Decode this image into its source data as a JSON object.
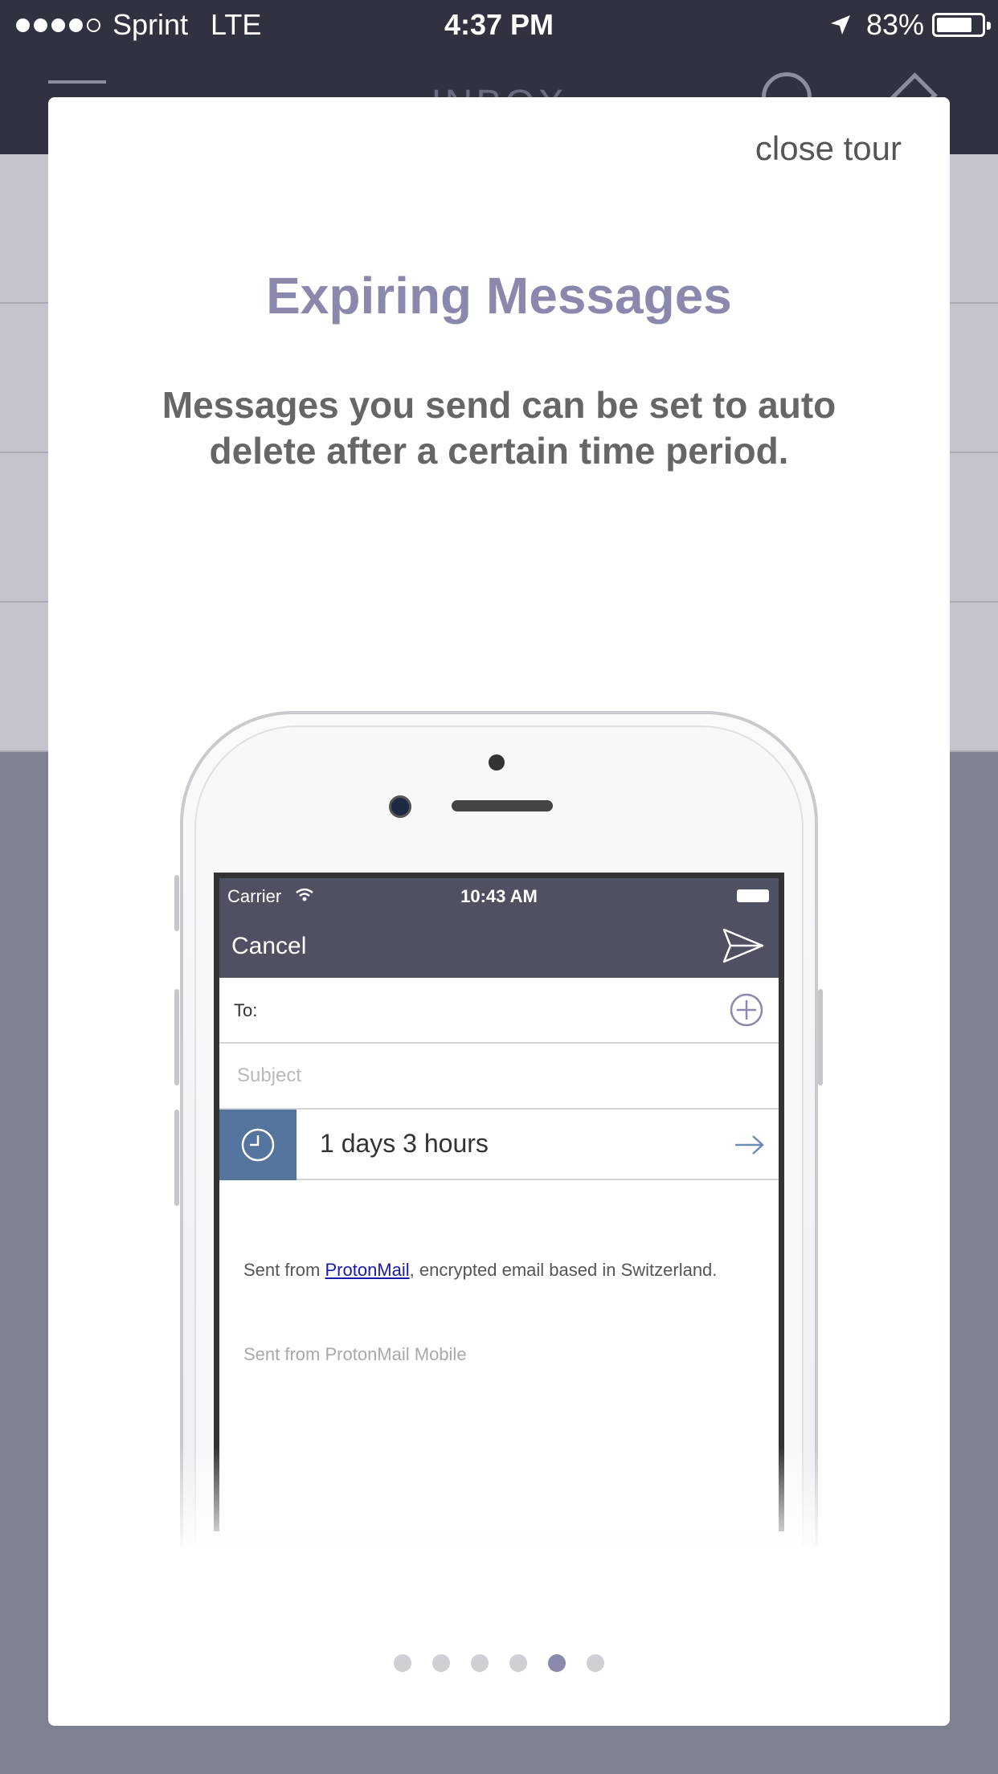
{
  "status_bar": {
    "carrier": "Sprint",
    "network": "LTE",
    "time": "4:37 PM",
    "battery": "83%",
    "signal_strength": 4
  },
  "background": {
    "title": "INBOX"
  },
  "tour": {
    "close_label": "close tour",
    "title": "Expiring Messages",
    "description": "Messages you send can be set to auto delete after a certain time period.",
    "page_count": 6,
    "active_page": 5
  },
  "illustration": {
    "carrier": "Carrier",
    "time": "10:43 AM",
    "cancel_label": "Cancel",
    "to_label": "To:",
    "subject_placeholder": "Subject",
    "expiration_value": "1 days 3 hours",
    "body_prefix": "Sent from ",
    "body_link": "ProtonMail",
    "body_suffix": ", encrypted email based in Switzerland.",
    "signature": "Sent from ProtonMail Mobile"
  },
  "colors": {
    "accent": "#8a89ad",
    "nav_bar": "#303240",
    "overlay": "#7e8190",
    "clock_box": "#55759f"
  }
}
